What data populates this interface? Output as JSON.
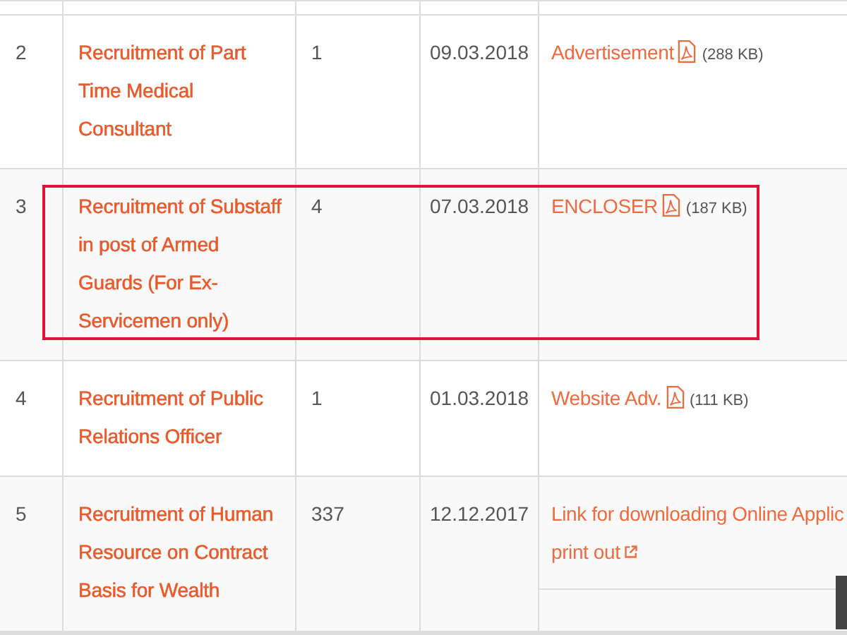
{
  "table": {
    "rows": [
      {
        "number": "2",
        "title": "Recruitment of Part Time Medical Consultant",
        "vacancies": "1",
        "date": "09.03.2018",
        "highlighted": false,
        "links": [
          {
            "kind": "pdf",
            "text": "Advertisement",
            "size": "(288 KB)"
          }
        ]
      },
      {
        "number": "3",
        "title": "Recruitment of Substaff in post of Armed Guards (For Ex-Servicemen only)",
        "vacancies": "4",
        "date": "07.03.2018",
        "highlighted": true,
        "links": [
          {
            "kind": "pdf",
            "text": "ENCLOSER",
            "size": "(187 KB)"
          }
        ]
      },
      {
        "number": "4",
        "title": "Recruitment of Public Relations Officer",
        "vacancies": "1",
        "date": "01.03.2018",
        "highlighted": false,
        "links": [
          {
            "kind": "pdf",
            "text": "Website Adv.",
            "size": "(111 KB)"
          }
        ]
      },
      {
        "number": "5",
        "title": "Recruitment of Human Resource on Contract Basis for Wealth",
        "vacancies": "337",
        "date": "12.12.2017",
        "highlighted": false,
        "links": [
          {
            "kind": "external",
            "text": "Link for downloading Online Applic\nprint out"
          }
        ]
      }
    ]
  }
}
